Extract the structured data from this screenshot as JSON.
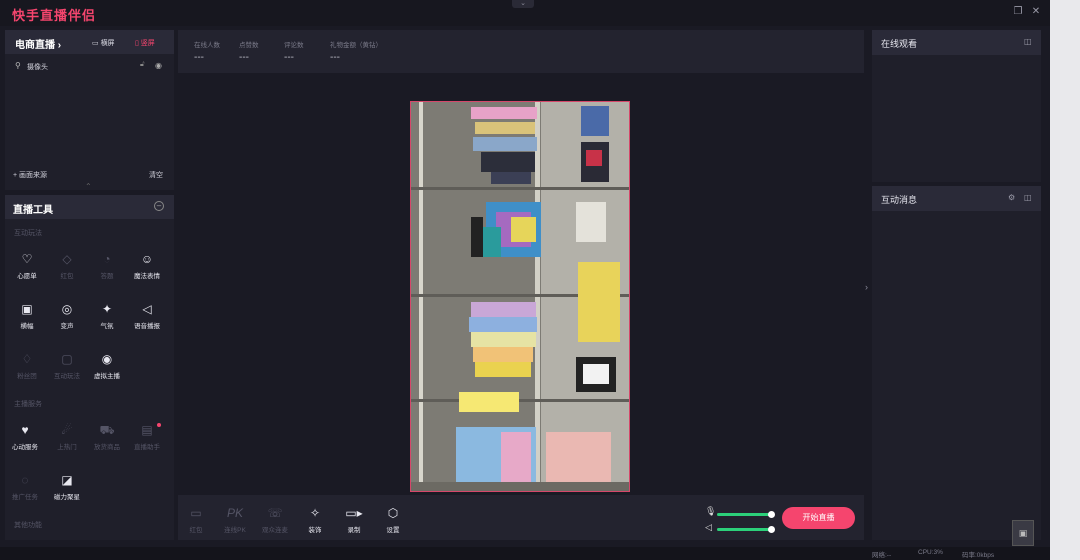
{
  "app": {
    "title": "快手直播伴侣"
  },
  "scene": {
    "live_mode": "电商直播 ›",
    "landscape": "横屏",
    "portrait": "竖屏",
    "source_name": "摄像头",
    "add_source": "+ 画面来源",
    "clear": "清空"
  },
  "tools": {
    "title": "直播工具",
    "sections": [
      "互动玩法",
      "主播服务",
      "其他功能"
    ],
    "items": [
      {
        "label": "心愿单",
        "icon": "wishlist-icon",
        "enabled": true
      },
      {
        "label": "红包",
        "icon": "red-packet-icon",
        "enabled": false
      },
      {
        "label": "答题",
        "icon": "quiz-icon",
        "enabled": false
      },
      {
        "label": "魔法表情",
        "icon": "magic-emoji-icon",
        "enabled": true
      },
      {
        "label": "横幅",
        "icon": "banner-icon",
        "enabled": true
      },
      {
        "label": "变声",
        "icon": "voice-change-icon",
        "enabled": true
      },
      {
        "label": "气氛",
        "icon": "party-icon",
        "enabled": true
      },
      {
        "label": "语音播报",
        "icon": "speaker-icon",
        "enabled": true
      },
      {
        "label": "粉丝团",
        "icon": "fan-club-icon",
        "enabled": false
      },
      {
        "label": "互动玩法",
        "icon": "game-icon",
        "enabled": false
      },
      {
        "label": "虚拟主播",
        "icon": "virtual-anchor-icon",
        "enabled": true
      },
      {
        "label": "心动服务",
        "icon": "heart-service-icon",
        "enabled": true
      },
      {
        "label": "上热门",
        "icon": "rocket-icon",
        "enabled": false
      },
      {
        "label": "放货商品",
        "icon": "cart-icon",
        "enabled": false
      },
      {
        "label": "直播助手",
        "icon": "assistant-icon",
        "enabled": false
      },
      {
        "label": "推广任务",
        "icon": "promo-task-icon",
        "enabled": false
      },
      {
        "label": "磁力聚星",
        "icon": "star-icon",
        "enabled": true
      }
    ]
  },
  "stats": [
    {
      "label": "在线人数",
      "value": "---"
    },
    {
      "label": "点赞数",
      "value": "---"
    },
    {
      "label": "评论数",
      "value": "---"
    },
    {
      "label": "礼物金额（黄钻）",
      "value": "---"
    }
  ],
  "bottom_tools": [
    {
      "label": "红包",
      "icon": "red-packet-icon",
      "enabled": false
    },
    {
      "label": "连线PK",
      "icon": "pk-icon",
      "enabled": false
    },
    {
      "label": "观众连麦",
      "icon": "co-host-icon",
      "enabled": false
    },
    {
      "label": "装饰",
      "icon": "decorate-icon",
      "enabled": true
    },
    {
      "label": "录制",
      "icon": "record-icon",
      "enabled": true
    },
    {
      "label": "设置",
      "icon": "settings-icon",
      "enabled": true
    }
  ],
  "audio": {
    "mic_level": 1.0,
    "speaker_level": 1.0
  },
  "start_button": "开始直播",
  "right_panels": {
    "viewers": "在线观看",
    "messages": "互动消息"
  },
  "status": {
    "network": "网络:--",
    "cpu": "CPU:3%",
    "bitrate": "码率:0kbps"
  },
  "colors": {
    "accent": "#f5456e",
    "level": "#2cd07a",
    "panel": "#1f1f2a"
  }
}
